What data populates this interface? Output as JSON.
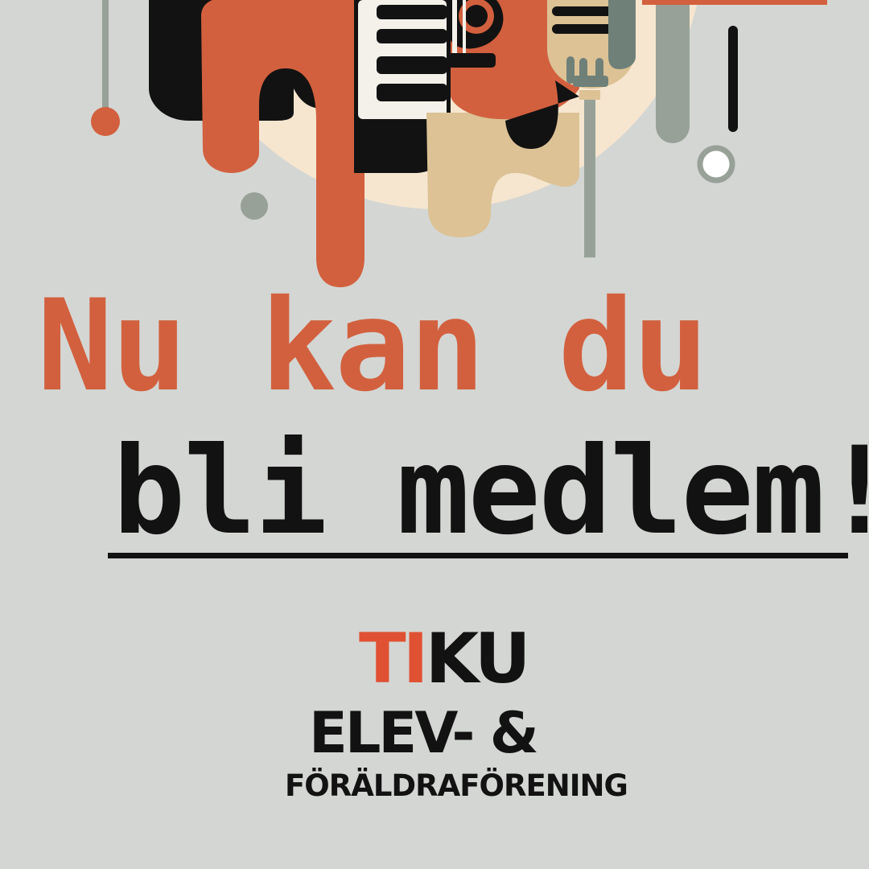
{
  "headline": {
    "line1": "Nu kan du",
    "line2": "bli medlem!"
  },
  "logo": {
    "mark_highlight": "TI",
    "mark_rest": "KU",
    "line2": "ELEV- &",
    "line3": "FÖRÄLDRAFÖRENING"
  },
  "colors": {
    "background": "#d4d6d3",
    "accent_orange": "#d2603e",
    "logo_red": "#e05133",
    "text_dark": "#121212",
    "cream": "#f6e6cf",
    "tan": "#dcc295",
    "sage": "#97a198"
  },
  "icons": [
    "keyboard-icon",
    "guitar-icon",
    "microphone-icon"
  ]
}
